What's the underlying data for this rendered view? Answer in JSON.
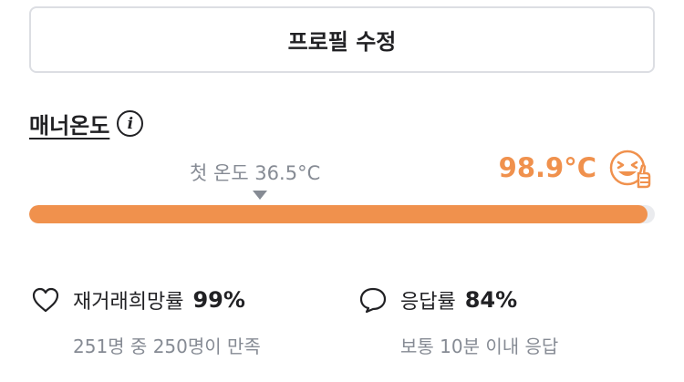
{
  "profile": {
    "edit_button_label": "프로필 수정"
  },
  "manner": {
    "title": "매너온도",
    "info_icon": "info-icon",
    "first_temp_label": "첫 온도 36.5°C",
    "current_temp": "98.9°C",
    "current_temp_value": 98.9,
    "first_temp_value": 36.5,
    "face_icon": "laughing-face-thumbs-up-icon",
    "bar_fill_fraction": 0.989,
    "accent_color": "#f0914d"
  },
  "stats": {
    "rehire": {
      "icon": "heart-icon",
      "label": "재거래희망률",
      "value": "99%",
      "sub": "251명 중 250명이 만족"
    },
    "response": {
      "icon": "speech-bubble-icon",
      "label": "응답률",
      "value": "84%",
      "sub": "보통 10분 이내 응답"
    }
  }
}
